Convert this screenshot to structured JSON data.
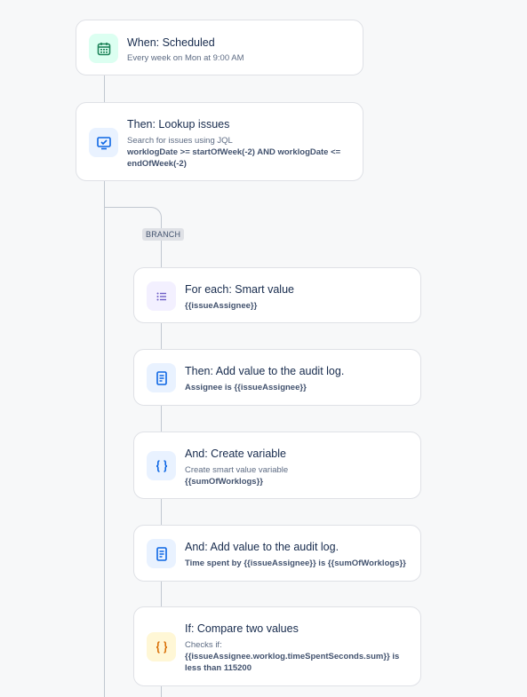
{
  "rule": {
    "trigger": {
      "title": "When: Scheduled",
      "description": "Every week on Mon at 9:00 AM",
      "icon": "calendar-icon",
      "icon_color": "#1f845a",
      "icon_bg": "#dcfff1"
    },
    "lookup": {
      "title": "Then: Lookup issues",
      "description": "Search for issues using JQL",
      "jql": "worklogDate >= startOfWeek(-2) AND worklogDate <= endOfWeek(-2)",
      "icon": "monitor-check-icon",
      "icon_color": "#0c66e4",
      "icon_bg": "#e9f2ff"
    },
    "branch": {
      "label": "BRANCH",
      "steps": [
        {
          "title": "For each: Smart value",
          "detail": "{{issueAssignee}}",
          "icon": "list-icon",
          "icon_color": "#6e5dc6",
          "icon_bg": "#f3f0ff"
        },
        {
          "title": "Then: Add value to the audit log.",
          "detail": "Assignee is {{issueAssignee}}",
          "icon": "document-icon",
          "icon_color": "#0c66e4",
          "icon_bg": "#e9f2ff"
        },
        {
          "title": "And: Create variable",
          "description": "Create smart value variable",
          "detail": "{{sumOfWorklogs}}",
          "icon": "braces-icon",
          "icon_color": "#0c66e4",
          "icon_bg": "#e9f2ff"
        },
        {
          "title": "And: Add value to the audit log.",
          "detail": "Time spent by {{issueAssignee}} is {{sumOfWorklogs}}",
          "icon": "document-icon",
          "icon_color": "#0c66e4",
          "icon_bg": "#e9f2ff"
        },
        {
          "title": "If: Compare two values",
          "description": "Checks if:",
          "detail": "{{issueAssignee.worklog.timeSpentSeconds.sum}} is less than 115200",
          "icon": "braces-icon",
          "icon_color": "#d97008",
          "icon_bg": "#fff7d6"
        }
      ]
    }
  }
}
